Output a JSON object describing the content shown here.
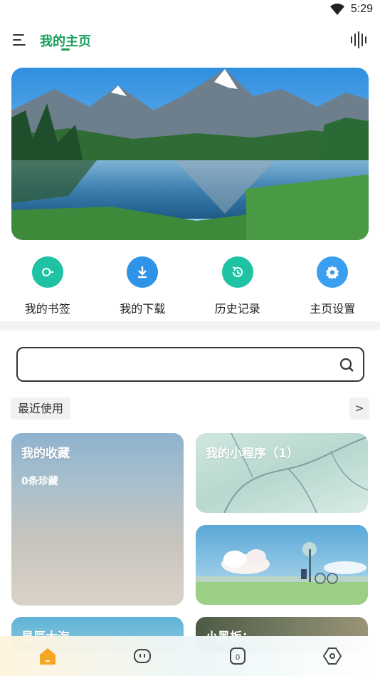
{
  "status_bar": {
    "time": "5:29"
  },
  "header": {
    "title": "我的主页"
  },
  "shortcuts": [
    {
      "label": "我的书签",
      "icon": "bookmark-icon",
      "color": "#1fc3a3"
    },
    {
      "label": "我的下载",
      "icon": "download-icon",
      "color": "#2f93e8"
    },
    {
      "label": "历史记录",
      "icon": "history-icon",
      "color": "#1fc3a3"
    },
    {
      "label": "主页设置",
      "icon": "settings-icon",
      "color": "#3a9ff0"
    }
  ],
  "search": {
    "placeholder": ""
  },
  "recent": {
    "label": "最近使用",
    "more_label": ">"
  },
  "cards": {
    "collect": {
      "title": "我的收藏",
      "subtitle": "0条珍藏"
    },
    "mini_program": {
      "title": "我的小程序（1）"
    },
    "sea": {
      "title": "星辰大海"
    },
    "board": {
      "title": "小黑板："
    }
  },
  "colors": {
    "accent": "#16a05c"
  }
}
